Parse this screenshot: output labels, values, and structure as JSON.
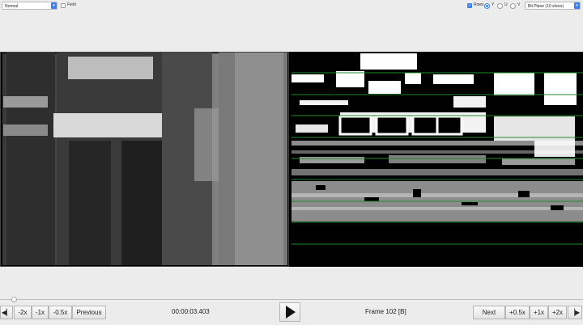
{
  "toolbar": {
    "display_mode": "Normal",
    "field_label": "Field",
    "rows_label": "Rows",
    "plane_y": "Y",
    "plane_u": "U",
    "plane_v": "V",
    "view_mode": "Bit Plane (10 slices)"
  },
  "controls": {
    "step_back_icon": "step-back-icon",
    "minus_2x": "-2x",
    "minus_1x": "-1x",
    "minus_05x": "-0.5x",
    "previous": "Previous",
    "timecode": "00:00:03.403",
    "play_icon": "play-icon",
    "frame_label": "Frame 102 [B]",
    "next": "Next",
    "plus_05x": "+0.5x",
    "plus_1x": "+1x",
    "plus_2x": "+2x",
    "step_forward_icon": "step-forward-icon"
  },
  "colors": {
    "accent": "#3b82f6",
    "row_line": "#1f8a2e"
  }
}
